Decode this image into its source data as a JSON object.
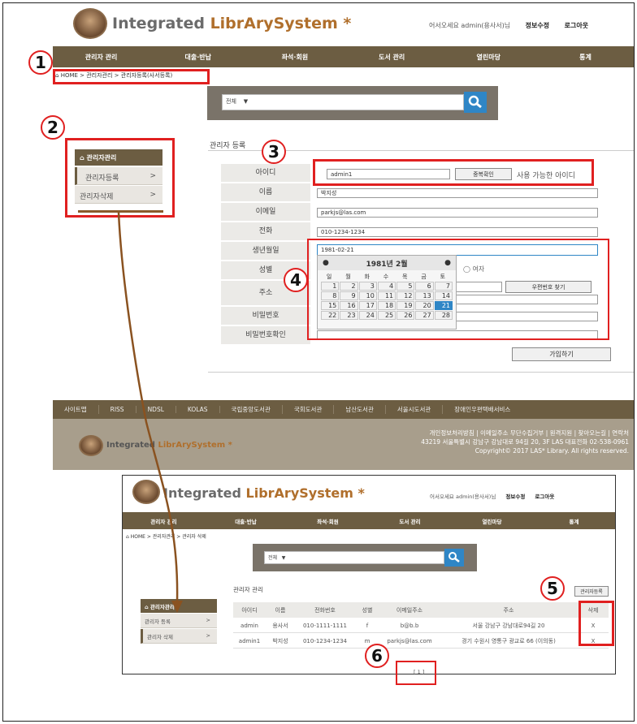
{
  "header": {
    "brand_integrated": "Integrated",
    "brand_library": "LibrArySystem *",
    "welcome": "어서오세요 admin(용사서)님",
    "edit_info": "정보수정",
    "logout": "로그아웃",
    "logo_text": "LAS"
  },
  "nav": [
    "관리자 관리",
    "대출·반납",
    "좌석·회원",
    "도서 관리",
    "열린마당",
    "통계"
  ],
  "breadcrumb": "HOME > 관리자관리 > 관리자등록(사서등록)",
  "search": {
    "select": "전체"
  },
  "sidebar": {
    "heading": "관리자관리",
    "items": [
      "관리자등록",
      "관리자삭제"
    ]
  },
  "form": {
    "title": "관리자 등록",
    "labels": [
      "아이디",
      "이름",
      "이메일",
      "전화",
      "생년월일",
      "성별",
      "주소",
      "비밀번호",
      "비밀번호확인"
    ],
    "id_value": "admin1",
    "dup_check": "중복확인",
    "id_status": "사용 가능한 아이디",
    "name_value": "박지성",
    "email_value": "parkjs@las.com",
    "phone_value": "010-1234-1234",
    "birth_value": "1981-02-21",
    "gender_female": "여자",
    "zip_button": "우편번호 찾기",
    "submit": "가입하기"
  },
  "calendar": {
    "title": "1981년 2월",
    "weekdays": [
      "일",
      "월",
      "화",
      "수",
      "목",
      "금",
      "토"
    ],
    "days": [
      "1",
      "2",
      "3",
      "4",
      "5",
      "6",
      "7",
      "8",
      "9",
      "10",
      "11",
      "12",
      "13",
      "14",
      "15",
      "16",
      "17",
      "18",
      "19",
      "20",
      "21",
      "22",
      "23",
      "24",
      "25",
      "26",
      "27",
      "28"
    ],
    "selected": "21"
  },
  "footer": {
    "links": [
      "사이트맵",
      "RISS",
      "NDSL",
      "KOLAS",
      "국립중앙도서관",
      "국회도서관",
      "남산도서관",
      "서울시도서관",
      "장애인우편택배서비스"
    ],
    "line1": "개인정보처리방침 | 이메일주소 무단수집거부 | 원격지원 | 찾아오는길 | 연락처",
    "line2": "43219 서울특별시 강남구 강남대로 94길 20, 3F LAS 대표전화 02-538-0961",
    "line3": "Copyright© 2017 LAS* Library. All rights reserved."
  },
  "sub": {
    "breadcrumb": "HOME > 관리자관리 > 관리자 삭제",
    "search_select": "전체",
    "title": "관리자 관리",
    "register_btn": "관리자등록",
    "sidebar_heading": "관리자관리",
    "sidebar_items": [
      "관리자 등록",
      "관리자 삭제"
    ],
    "columns": [
      "아이디",
      "이름",
      "전화번호",
      "성별",
      "이메일주소",
      "주소",
      "삭제"
    ],
    "rows": [
      [
        "admin",
        "용사서",
        "010-1111-1111",
        "f",
        "b@b.b",
        "서울 강남구 강남대로94길 20",
        "X"
      ],
      [
        "admin1",
        "박지성",
        "010-1234-1234",
        "m",
        "parkjs@las.com",
        "경기 수원시 영통구 광교로 66 (이의동)",
        "X"
      ]
    ],
    "pager": "[ 1 ]"
  },
  "badges": [
    "1",
    "2",
    "3",
    "4",
    "5",
    "6"
  ],
  "colors": {
    "nav_bg": "#6c5d42",
    "accent_blue": "#2f86c6",
    "annotation_red": "#e02020"
  }
}
